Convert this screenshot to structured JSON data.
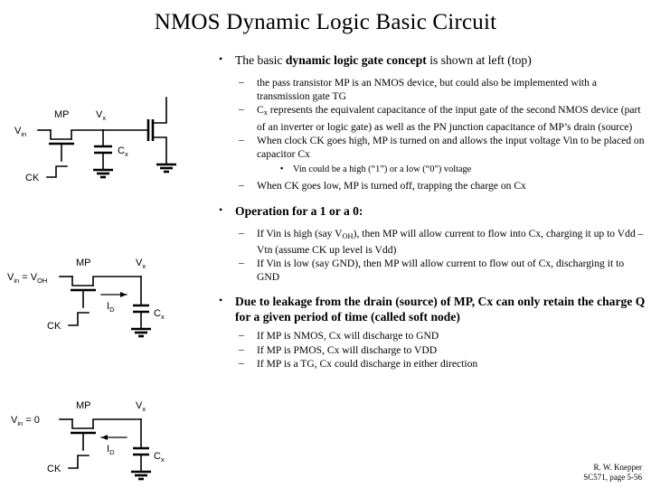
{
  "slide": {
    "title": "NMOS Dynamic Logic Basic Circuit"
  },
  "bullets": {
    "b1_a_lead": "The basic ",
    "b1_a_bold": "dynamic logic gate concept",
    "b1_a_tail": " is shown at left (top)",
    "b2_a": "the pass transistor MP is an NMOS device, but could also be implemented with a transmission gate TG",
    "b2_b_pre": "C",
    "b2_b_sub": "x",
    "b2_b_post": " represents the equivalent capacitance of the input gate of the second NMOS device (part of an inverter or logic gate) as well as the PN junction capacitance of MP’s drain (source)",
    "b2_c": "When clock CK goes high, MP is turned on and allows the input voltage Vin to be placed on capacitor Cx",
    "b3_a": "Vin could be a high (“1”) or a low (“0”) voltage",
    "b2_d": "When CK goes low, MP is turned off, trapping the charge on Cx",
    "b1_b": "Operation for a 1 or a 0:",
    "b2_e_pre": "If Vin is high (say V",
    "b2_e_sub": "OH",
    "b2_e_post": "), then MP will allow current to flow into Cx, charging it up to Vdd – Vtn (assume CK up level is Vdd)",
    "b2_f": "If Vin is low (say GND), then MP will allow current to flow out of Cx, discharging it to GND",
    "b1_c": "Due to leakage from the drain (source) of MP, Cx can only retain the charge Q for a given period of time (called soft node)",
    "b2_g": "If MP is NMOS, Cx will discharge to GND",
    "b2_h": "If MP is PMOS, Cx will discharge to VDD",
    "b2_i": "If MP is a TG, Cx could discharge in either direction",
    "marker_l1": "•",
    "marker_l2": "–",
    "marker_l3": "▪"
  },
  "figures": {
    "top": {
      "vin": "V",
      "vin_sub": "in",
      "mp": "MP",
      "vx": "V",
      "vx_sub": "x",
      "cx": "C",
      "cx_sub": "x",
      "ck": "CK"
    },
    "mid": {
      "vin": "V",
      "vin_sub": "in",
      "vin_eq": " = V",
      "vin_eq_sub": "OH",
      "mp": "MP",
      "vx": "V",
      "vx_sub": "x",
      "cx": "C",
      "cx_sub": "x",
      "ck": "CK",
      "id": "I",
      "id_sub": "D"
    },
    "bot": {
      "vin": "V",
      "vin_sub": "in",
      "vin_eq": " = 0",
      "mp": "MP",
      "vx": "V",
      "vx_sub": "x",
      "cx": "C",
      "cx_sub": "x",
      "ck": "CK",
      "id": "I",
      "id_sub": "D"
    }
  },
  "footer": {
    "author": "R. W. Knepper",
    "reference": "SC571, page 5-56"
  },
  "colors": {
    "background": "#ffffff",
    "text": "#000000"
  }
}
